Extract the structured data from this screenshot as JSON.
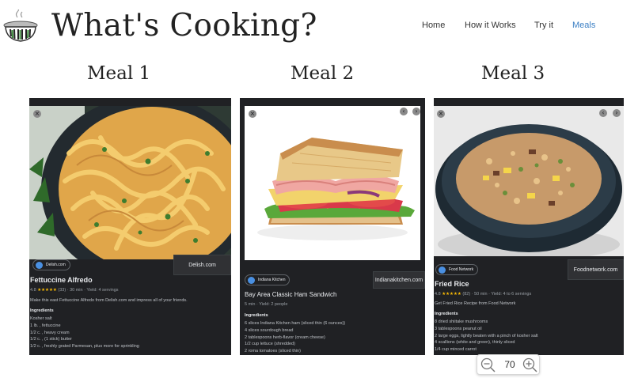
{
  "header": {
    "site_title": "What's Cooking?",
    "logo_icon": "cooking-pot-icon"
  },
  "nav": {
    "items": [
      {
        "label": "Home",
        "active": false
      },
      {
        "label": "How it Works",
        "active": false
      },
      {
        "label": "Try it",
        "active": false
      },
      {
        "label": "Meals",
        "active": true
      }
    ],
    "active_color": "#3b7fc4"
  },
  "meals": [
    {
      "heading": "Meal 1",
      "image_icon": "fettuccine-photo",
      "source": "Delish.com",
      "visit_label": "Delish.com",
      "title": "Fettuccine Alfredo",
      "rating": "4.8",
      "stars": "★★★★★",
      "reviews": "(33)",
      "time": "30 min",
      "yield": "Yield: 4 servings",
      "description": "Make this east Fettuccine Alfredo from Delish.com and impress all of your friends.",
      "ingredients_label": "Ingredients",
      "ingredients": [
        "Kosher salt",
        "1 lb. , fettuccine",
        "1/2 c. , heavy cream",
        "1/2 c. , (1 stick) butter",
        "1/2 c. , freshly grated Parmesan, plus more for sprinkling"
      ]
    },
    {
      "heading": "Meal 2",
      "image_icon": "ham-sandwich-photo",
      "source": "Indiana Kitchen",
      "visit_label": "Indianakitchen.com",
      "title": "Bay Area Classic Ham Sandwich",
      "time": "5 min",
      "yield": "Yield: 2 people",
      "ingredients_label": "Ingredients",
      "ingredients": [
        "6 slices Indiana Kitchen ham (sliced thin (6 ounces))",
        "4 slices sourdough bread",
        "2 tablespoons herb-flavor (cream cheese)",
        "1/2 cup lettuce (shredded)",
        "2 roma tomatoes (sliced thin)"
      ]
    },
    {
      "heading": "Meal 3",
      "image_icon": "fried-rice-photo",
      "source": "Food Network",
      "visit_label": "Foodnetwork.com",
      "title": "Fried Rice",
      "rating": "4.8",
      "stars": "★★★★★",
      "reviews": "(82)",
      "time": "50 min",
      "yield": "Yield: 4 to 6 servings",
      "description": "Get Fried Rice Recipe from Food Network",
      "ingredients_label": "Ingredients",
      "ingredients": [
        "8 dried shiitake mushrooms",
        "3 tablespoons peanut oil",
        "2 large eggs, lightly beaten with a pinch of kosher salt",
        "4 scallions (white and green), thinly sliced",
        "1/4 cup minced carrot"
      ]
    }
  ],
  "card_ui": {
    "close_glyph": "×",
    "prev_glyph": "‹",
    "next_glyph": "›",
    "dot": "·"
  },
  "zoom": {
    "value": "70",
    "zoom_out_icon": "zoom-out-icon",
    "zoom_in_icon": "zoom-in-icon"
  },
  "colors": {
    "card_bg": "#202124",
    "card_text": "#e8eaed",
    "star": "#fbbc04"
  }
}
